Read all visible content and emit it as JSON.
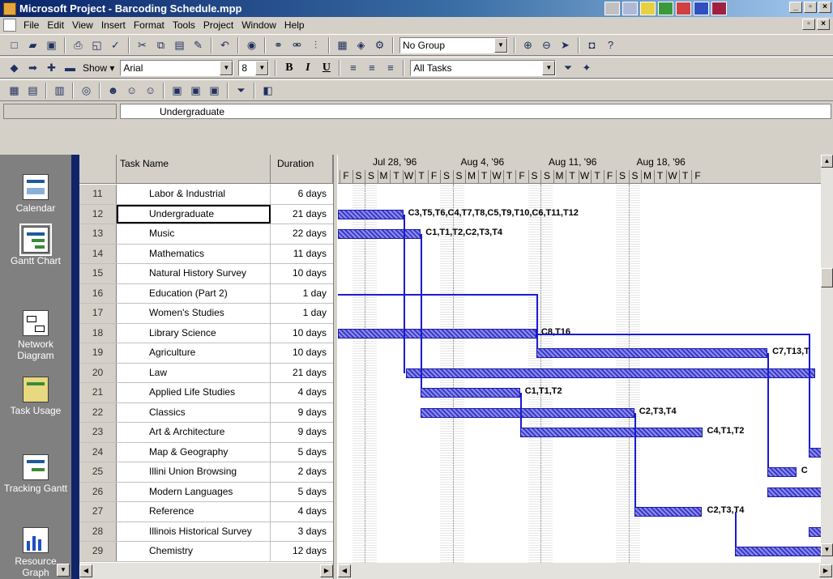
{
  "window": {
    "title": "Microsoft Project - Barcoding Schedule.mpp"
  },
  "menu": [
    "File",
    "Edit",
    "View",
    "Insert",
    "Format",
    "Tools",
    "Project",
    "Window",
    "Help"
  ],
  "toolbar": {
    "group_value": "No Group",
    "show_label": "Show",
    "font_value": "Arial",
    "size_value": "8",
    "bold": "B",
    "italic": "I",
    "underline": "U",
    "filter_value": "All Tasks"
  },
  "entry_bar": {
    "value": "Undergraduate"
  },
  "view_bar": [
    "Calendar",
    "Gantt Chart",
    "Network Diagram",
    "Task Usage",
    "Tracking Gantt",
    "Resource Graph"
  ],
  "columns": {
    "name": "Task Name",
    "duration": "Duration"
  },
  "timescale": {
    "weeks": [
      "Jul 28, '96",
      "Aug 4, '96",
      "Aug 11, '96",
      "Aug 18, '96"
    ],
    "days": [
      "F",
      "S",
      "S",
      "M",
      "T",
      "W",
      "T",
      "F",
      "S",
      "S",
      "M",
      "T",
      "W",
      "T",
      "F",
      "S",
      "S",
      "M",
      "T",
      "W",
      "T",
      "F",
      "S",
      "S",
      "M",
      "T",
      "W",
      "T",
      "F"
    ]
  },
  "tasks": [
    {
      "id": "11",
      "name": "Labor & Industrial",
      "duration": "6 days"
    },
    {
      "id": "12",
      "name": "Undergraduate",
      "duration": "21 days"
    },
    {
      "id": "13",
      "name": "Music",
      "duration": "22 days"
    },
    {
      "id": "14",
      "name": "Mathematics",
      "duration": "11 days"
    },
    {
      "id": "15",
      "name": "Natural History Survey",
      "duration": "10 days"
    },
    {
      "id": "16",
      "name": "Education (Part 2)",
      "duration": "1 day"
    },
    {
      "id": "17",
      "name": "Women's Studies",
      "duration": "1 day"
    },
    {
      "id": "18",
      "name": "Library Science",
      "duration": "10 days"
    },
    {
      "id": "19",
      "name": "Agriculture",
      "duration": "10 days"
    },
    {
      "id": "20",
      "name": "Law",
      "duration": "21 days"
    },
    {
      "id": "21",
      "name": "Applied Life Studies",
      "duration": "4 days"
    },
    {
      "id": "22",
      "name": "Classics",
      "duration": "9 days"
    },
    {
      "id": "23",
      "name": "Art & Architecture",
      "duration": "9 days"
    },
    {
      "id": "24",
      "name": "Map & Geography",
      "duration": "5 days"
    },
    {
      "id": "25",
      "name": "Illini Union Browsing",
      "duration": "2 days"
    },
    {
      "id": "26",
      "name": "Modern Languages",
      "duration": "5 days"
    },
    {
      "id": "27",
      "name": "Reference",
      "duration": "4 days"
    },
    {
      "id": "28",
      "name": "Illinois Historical Survey",
      "duration": "3 days"
    },
    {
      "id": "29",
      "name": "Chemistry",
      "duration": "12 days"
    }
  ],
  "bar_labels": {
    "12": "C3,T5,T6,C4,T7,T8,C5,T9,T10,C6,T11,T12",
    "13": "C1,T1,T2,C2,T3,T4",
    "18": "C8,T16",
    "19": "C7,T13,T",
    "21": "C1,T1,T2",
    "22": "C2,T3,T4",
    "23": "C4,T1,T2",
    "25": "C",
    "27": "C2,T3,T4"
  }
}
